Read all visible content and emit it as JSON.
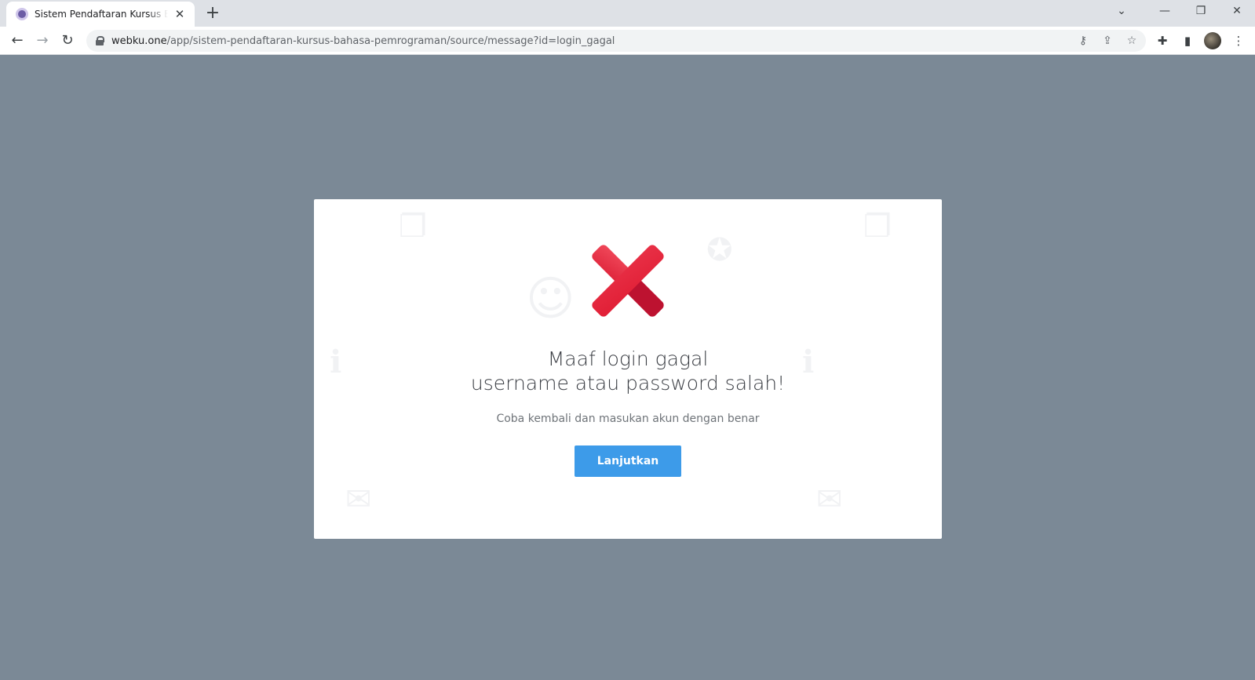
{
  "browser": {
    "tab_title": "Sistem Pendaftaran Kursus Bahasa Pemrograman",
    "url_host": "webku.one",
    "url_path": "/app/sistem-pendaftaran-kursus-bahasa-pemrograman/source/message?id=login_gagal",
    "icons": {
      "back": "back-arrow-icon",
      "forward": "forward-arrow-icon",
      "reload": "reload-icon",
      "key": "key-icon",
      "share": "share-icon",
      "bookmark": "star-icon",
      "extensions": "puzzle-icon",
      "side_panel": "side-panel-icon",
      "menu": "kebab-menu-icon"
    }
  },
  "message": {
    "title_line1": "Maaf login gagal",
    "title_line2": "username atau password salah!",
    "description": "Coba kembali dan masukan akun dengan benar",
    "button_label": "Lanjutkan",
    "icon": "error-cross-icon"
  },
  "colors": {
    "page_background": "#7b8996",
    "card_background": "#ffffff",
    "button": "#3d9be9",
    "error_red": "#e8213a",
    "error_dark_red": "#b80f2c"
  }
}
